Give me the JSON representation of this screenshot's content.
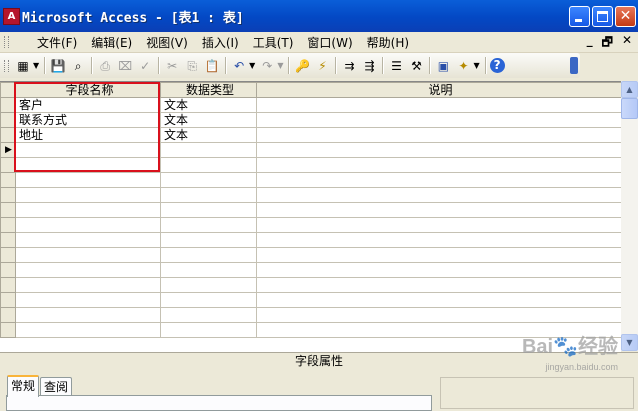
{
  "window": {
    "title": "Microsoft Access - [表1 : 表]",
    "app_icon_letter": "A"
  },
  "menu": {
    "items": [
      "文件(F)",
      "编辑(E)",
      "视图(V)",
      "插入(I)",
      "工具(T)",
      "窗口(W)",
      "帮助(H)"
    ],
    "mdi_controls": [
      "_",
      "🗗",
      "✕"
    ]
  },
  "toolbar": {
    "buttons": [
      {
        "icon": "design-view-icon",
        "glyph": "▦",
        "enabled": true
      },
      {
        "icon": "save-icon",
        "glyph": "💾",
        "enabled": true
      },
      {
        "icon": "search-icon",
        "glyph": "⌕",
        "enabled": true
      },
      {
        "icon": "print-icon",
        "glyph": "⎙",
        "enabled": false
      },
      {
        "icon": "print-preview-icon",
        "glyph": "⌧",
        "enabled": false
      },
      {
        "icon": "spelling-icon",
        "glyph": "✓",
        "enabled": false
      },
      {
        "icon": "cut-icon",
        "glyph": "✂",
        "enabled": false
      },
      {
        "icon": "copy-icon",
        "glyph": "⎘",
        "enabled": false
      },
      {
        "icon": "paste-icon",
        "glyph": "📋",
        "enabled": true
      },
      {
        "icon": "undo-icon",
        "glyph": "↶",
        "enabled": true
      },
      {
        "icon": "redo-icon",
        "glyph": "↷",
        "enabled": false
      },
      {
        "icon": "primary-key-icon",
        "glyph": "🔑",
        "enabled": true
      },
      {
        "icon": "indexes-icon",
        "glyph": "⚡",
        "enabled": true
      },
      {
        "icon": "insert-rows-icon",
        "glyph": "⇉",
        "enabled": true
      },
      {
        "icon": "delete-rows-icon",
        "glyph": "⇶",
        "enabled": true
      },
      {
        "icon": "properties-icon",
        "glyph": "☰",
        "enabled": true
      },
      {
        "icon": "build-icon",
        "glyph": "⚒",
        "enabled": true
      },
      {
        "icon": "database-window-icon",
        "glyph": "▣",
        "enabled": true
      },
      {
        "icon": "new-object-icon",
        "glyph": "✦",
        "enabled": true
      },
      {
        "icon": "help-icon",
        "glyph": "?",
        "enabled": true
      }
    ]
  },
  "grid": {
    "headers": {
      "field_name": "字段名称",
      "data_type": "数据类型",
      "description": "说明"
    },
    "rows": [
      {
        "field_name": "客户",
        "data_type": "文本",
        "description": ""
      },
      {
        "field_name": "联系方式",
        "data_type": "文本",
        "description": ""
      },
      {
        "field_name": "地址",
        "data_type": "文本",
        "description": ""
      }
    ],
    "current_row_marker": "▶"
  },
  "properties": {
    "title": "字段属性",
    "tabs": [
      "常规",
      "查阅"
    ],
    "active_tab": "常规"
  },
  "colors": {
    "titlebar": "#0348c4",
    "highlight_box": "#d9101c",
    "chrome": "#ece9d8"
  },
  "watermark": {
    "text": "Bai🐾经验",
    "sub": "jingyan.baidu.com"
  }
}
